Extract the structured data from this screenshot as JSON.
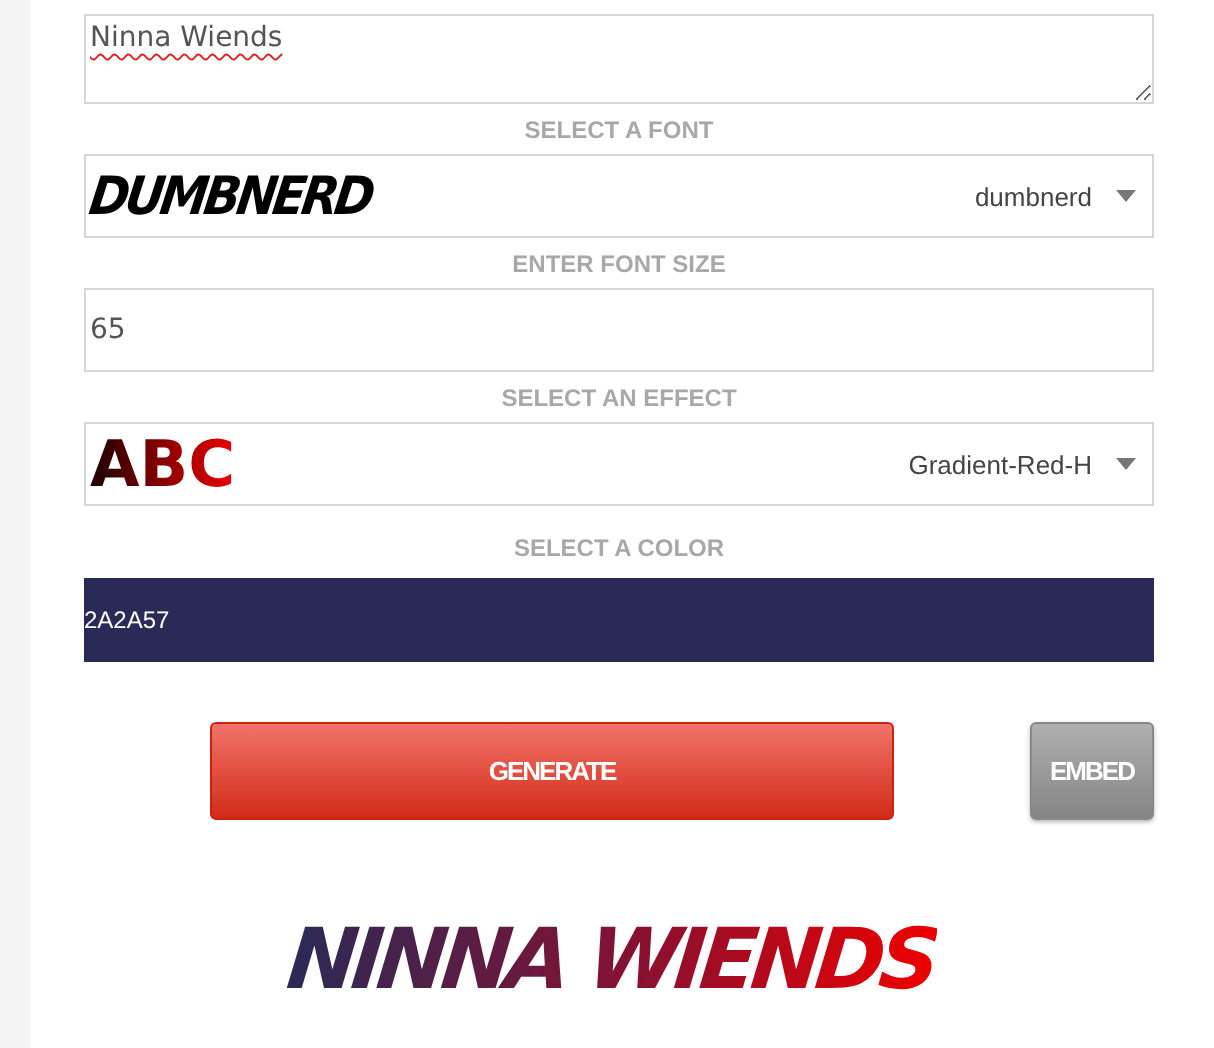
{
  "text_input": {
    "value": "Ninna Wiends"
  },
  "font_section": {
    "label": "SELECT A FONT",
    "preview": "DUMBNERD",
    "value": "dumbnerd"
  },
  "size_section": {
    "label": "ENTER FONT SIZE",
    "value": "65"
  },
  "effect_section": {
    "label": "SELECT AN EFFECT",
    "preview": "ABC",
    "value": "Gradient-Red-H"
  },
  "color_section": {
    "label": "SELECT A COLOR",
    "value": "2A2A57"
  },
  "buttons": [
    {
      "label": "GENERATE",
      "kind": "primary"
    },
    {
      "label": "EMBED",
      "kind": "secondary"
    }
  ],
  "result": {
    "text": "NINNA WIENDS"
  }
}
